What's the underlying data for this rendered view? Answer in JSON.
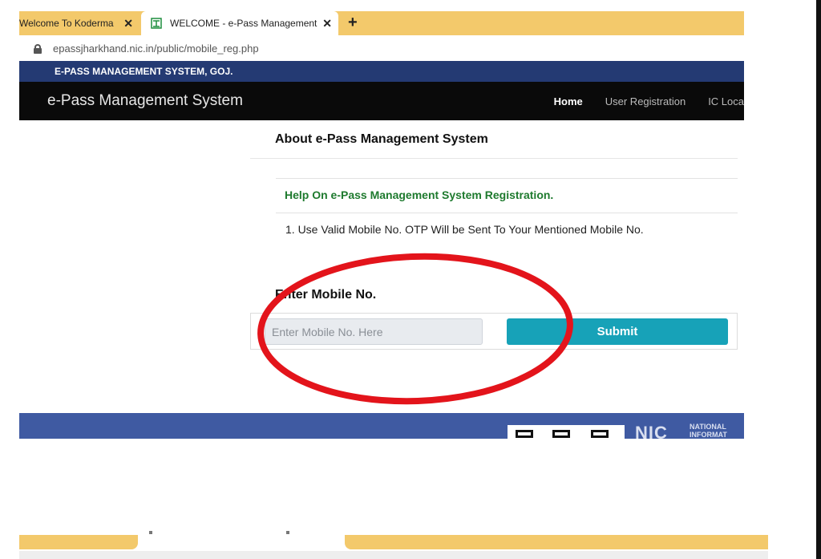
{
  "browser": {
    "tabs": [
      {
        "title": "Welcome To Koderma",
        "active": false
      },
      {
        "title": "WELCOME - e-Pass Management",
        "active": true
      }
    ],
    "new_tab_symbol": "+",
    "close_symbol": "✕",
    "url": "epassjharkhand.nic.in/public/mobile_reg.php"
  },
  "site": {
    "top_strip": "E-PASS MANAGEMENT SYSTEM, GOJ.",
    "brand": "e-Pass Management System",
    "nav": [
      "Home",
      "User Registration",
      "IC Loca"
    ]
  },
  "content": {
    "about_heading": "About e-Pass Management System",
    "help_heading": "Help On e-Pass Management System Registration.",
    "instruction": "1. Use Valid Mobile No. OTP Will be Sent To Your Mentioned Mobile No.",
    "mobile_label": "Enter Mobile No.",
    "mobile_placeholder": "Enter Mobile No. Here",
    "submit_label": "Submit"
  },
  "footer": {
    "logo_text": "NIC",
    "org_line1": "NATIONAL",
    "org_line2": "INFORMAT"
  },
  "colors": {
    "tab_bar": "#f3c96b",
    "top_strip": "#243a73",
    "navbar": "#0a0a0a",
    "help_text": "#1e7a2e",
    "submit_button": "#17a2b8",
    "footer": "#3f5aa2",
    "annotation_circle": "#e3141b"
  }
}
